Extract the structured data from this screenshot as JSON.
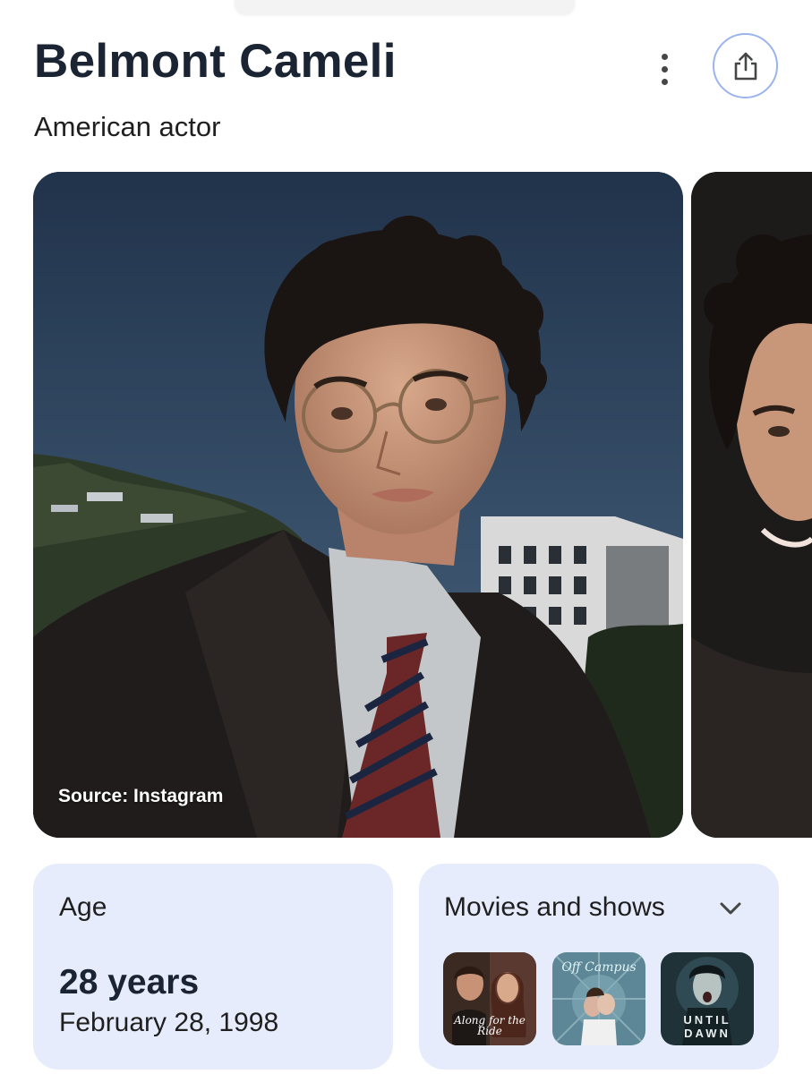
{
  "header": {
    "title": "Belmont Cameli",
    "subtitle": "American actor"
  },
  "icons": {
    "more": "more-vertical-icon",
    "share": "share-icon",
    "expand": "chevron-down-icon"
  },
  "photos": {
    "main_source": "Source: Instagram"
  },
  "age_card": {
    "label": "Age",
    "value": "28 years",
    "birth_date": "February 28, 1998"
  },
  "movies_card": {
    "label": "Movies and shows",
    "items": [
      {
        "title": "Along for the Ride"
      },
      {
        "title": "Off Campus"
      },
      {
        "title": "Until Dawn"
      }
    ]
  },
  "colors": {
    "accent_border": "#9bb4ee",
    "card_background": "#e6ecfb",
    "title_text": "#1b2433"
  }
}
